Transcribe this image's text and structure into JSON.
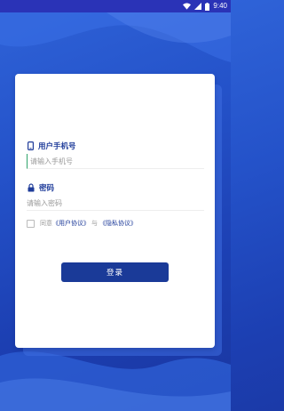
{
  "status_bar": {
    "time": "9:40",
    "icons": [
      "wifi-icon",
      "signal-icon",
      "battery-icon"
    ]
  },
  "login": {
    "phone_label": "用户手机号",
    "phone_placeholder": "请输入手机号",
    "password_label": "密码",
    "password_placeholder": "请输入密码",
    "agree_prefix": "同意",
    "user_agreement": "《用户协议》",
    "agree_and": "与",
    "privacy_policy": "《隐私协议》",
    "agreement_checked": false,
    "submit_label": "登录"
  },
  "colors": {
    "accent": "#1f3c9a",
    "button": "#1a3a98",
    "status_bar": "#2a33b7",
    "background": "#2452c9"
  }
}
